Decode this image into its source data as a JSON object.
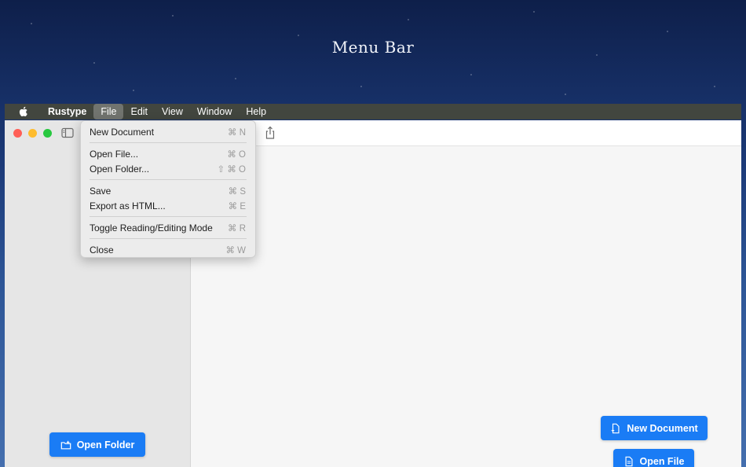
{
  "header": {
    "title": "Menu Bar"
  },
  "menubar": {
    "app_name": "Rustype",
    "items": [
      "File",
      "Edit",
      "View",
      "Window",
      "Help"
    ],
    "active": "File"
  },
  "file_menu": {
    "groups": [
      [
        {
          "label": "New Document",
          "shortcut": "⌘ N"
        }
      ],
      [
        {
          "label": "Open File...",
          "shortcut": "⌘ O"
        },
        {
          "label": "Open Folder...",
          "shortcut": "⇧ ⌘ O"
        }
      ],
      [
        {
          "label": "Save",
          "shortcut": "⌘ S"
        },
        {
          "label": "Export as HTML...",
          "shortcut": "⌘ E"
        }
      ],
      [
        {
          "label": "Toggle Reading/Editing Mode",
          "shortcut": "⌘ R"
        }
      ],
      [
        {
          "label": "Close",
          "shortcut": "⌘ W"
        }
      ]
    ]
  },
  "sidebar": {
    "open_folder_label": "Open Folder"
  },
  "main": {
    "new_document_label": "New Document",
    "open_file_label": "Open File"
  },
  "colors": {
    "accent": "#1a7cf5",
    "close": "#ff5f57",
    "minimize": "#febc2e",
    "maximize": "#28c840"
  },
  "icons": [
    "apple-icon",
    "sidebar-toggle-icon",
    "share-icon",
    "folder-icon",
    "document-new-icon",
    "document-icon"
  ]
}
